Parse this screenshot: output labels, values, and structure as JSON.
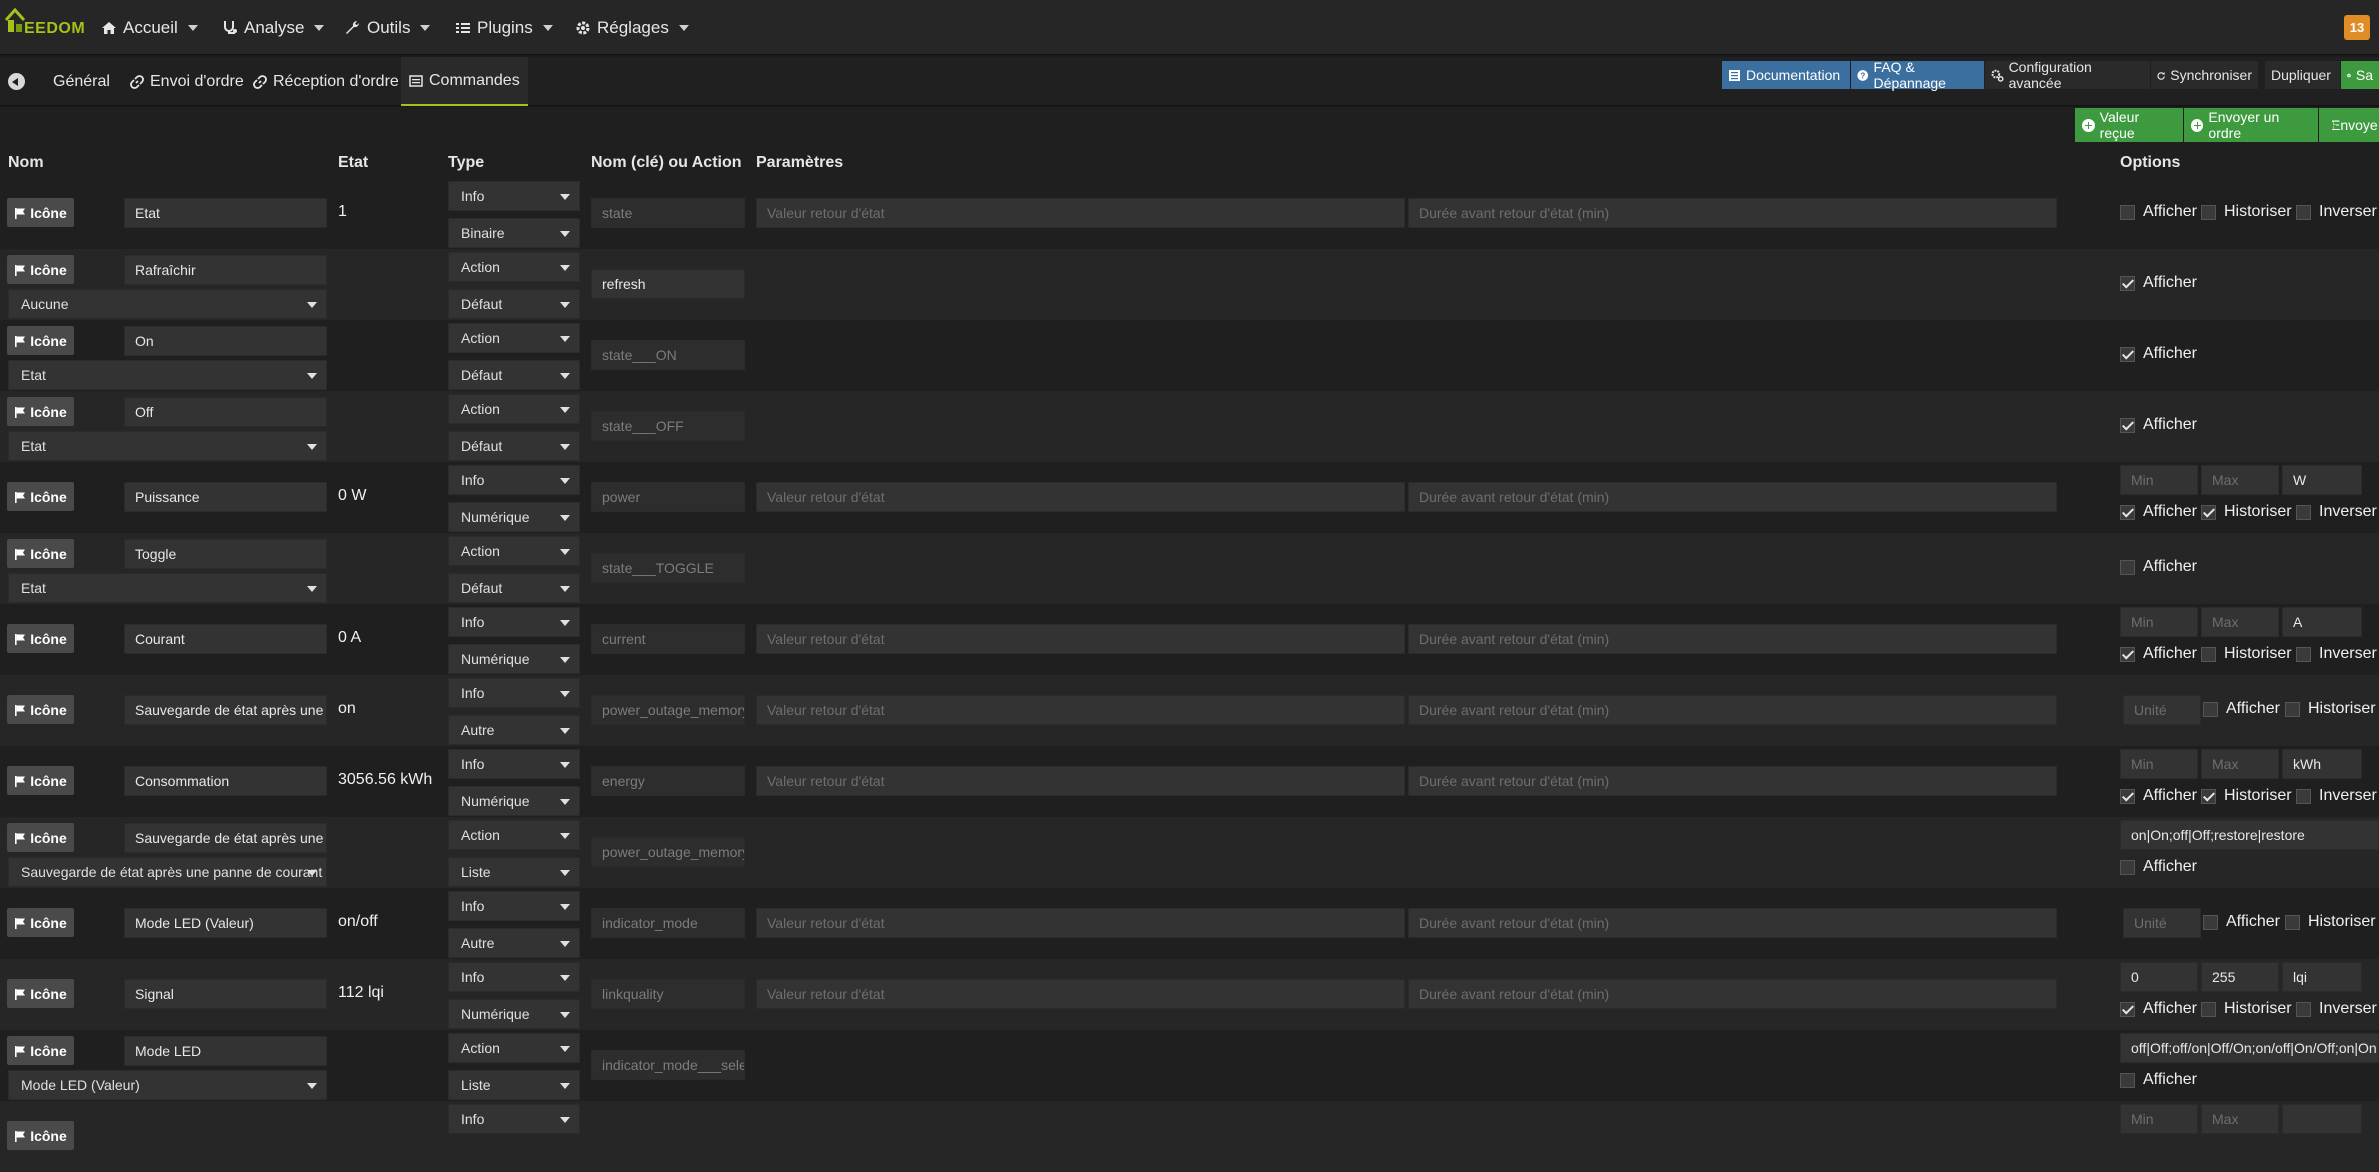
{
  "navbar": {
    "logo_text": "EEDOM",
    "items": [
      {
        "label": "Accueil",
        "icon": "home-icon"
      },
      {
        "label": "Analyse",
        "icon": "stethoscope-icon"
      },
      {
        "label": "Outils",
        "icon": "wrench-icon"
      },
      {
        "label": "Plugins",
        "icon": "list-icon"
      },
      {
        "label": "Réglages",
        "icon": "gear-icon"
      }
    ],
    "badge": "13"
  },
  "tabs": [
    "Général",
    "Envoi d'ordre",
    "Réception d'ordre",
    "Commandes"
  ],
  "toolbar": {
    "documentation": "Documentation",
    "faq": "FAQ & Dépannage",
    "config": "Configuration avancée",
    "sync": "Synchroniser",
    "duplicate": "Dupliquer",
    "save": "Sa"
  },
  "actions": {
    "valeur_recue": "Valeur reçue",
    "envoyer_ordre": "Envoyer un ordre",
    "envoyer": "Envoye"
  },
  "columns": {
    "nom": "Nom",
    "etat": "Etat",
    "type": "Type",
    "key": "Nom (clé) ou Action",
    "params": "Paramètres",
    "options": "Options"
  },
  "labels": {
    "icone": "Icône",
    "afficher": "Afficher",
    "historiser": "Historiser",
    "inverser": "Inverser",
    "param1": "Valeur retour d'état",
    "param2": "Durée avant retour d'état (min)",
    "min": "Min",
    "max": "Max",
    "unite": "Unité"
  },
  "rows": [
    {
      "name": "Etat",
      "etat": "1",
      "type": "Info",
      "subtype": "Binaire",
      "key": "state",
      "params": true,
      "options": "afficher-hist-inv",
      "afficher": false,
      "historiser": false,
      "inverser": false
    },
    {
      "name": "Rafraîchir",
      "linked": "Aucune",
      "type": "Action",
      "subtype": "Défaut",
      "key": "refresh",
      "key_bright": true,
      "options": "afficher",
      "afficher": true
    },
    {
      "name": "On",
      "linked": "Etat",
      "type": "Action",
      "subtype": "Défaut",
      "key": "state___ON",
      "options": "afficher",
      "afficher": true
    },
    {
      "name": "Off",
      "linked": "Etat",
      "type": "Action",
      "subtype": "Défaut",
      "key": "state___OFF",
      "options": "afficher",
      "afficher": true
    },
    {
      "name": "Puissance",
      "etat": "0 W",
      "type": "Info",
      "subtype": "Numérique",
      "key": "power",
      "params": true,
      "options": "minmax",
      "min": "",
      "max": "",
      "unit": "W",
      "afficher": true,
      "historiser": true,
      "inverser": false
    },
    {
      "name": "Toggle",
      "linked": "Etat",
      "type": "Action",
      "subtype": "Défaut",
      "key": "state___TOGGLE",
      "options": "afficher",
      "afficher": false
    },
    {
      "name": "Courant",
      "etat": "0 A",
      "type": "Info",
      "subtype": "Numérique",
      "key": "current",
      "params": true,
      "options": "minmax",
      "min": "",
      "max": "",
      "unit": "A",
      "afficher": true,
      "historiser": false,
      "inverser": false
    },
    {
      "name": "Sauvegarde de état après une panne de courant",
      "etat": "on",
      "type": "Info",
      "subtype": "Autre",
      "key": "power_outage_memory",
      "params": true,
      "options": "unite",
      "afficher": false,
      "historiser": false
    },
    {
      "name": "Consommation",
      "etat": "3056.56 kWh",
      "type": "Info",
      "subtype": "Numérique",
      "key": "energy",
      "params": true,
      "options": "minmax",
      "min": "",
      "max": "",
      "unit": "kWh",
      "afficher": true,
      "historiser": true,
      "inverser": false
    },
    {
      "name": "Sauvegarde de état après une panne de courant",
      "linked": "Sauvegarde de état après une panne de courant",
      "type": "Action",
      "subtype": "Liste",
      "key": "power_outage_memory",
      "options": "list",
      "list": "on|On;off|Off;restore|restore",
      "afficher": false
    },
    {
      "name": "Mode LED (Valeur)",
      "etat": "on/off",
      "type": "Info",
      "subtype": "Autre",
      "key": "indicator_mode",
      "params": true,
      "options": "unite",
      "afficher": false,
      "historiser": false
    },
    {
      "name": "Signal",
      "etat": "112 lqi",
      "type": "Info",
      "subtype": "Numérique",
      "key": "linkquality",
      "params": true,
      "options": "minmax",
      "min": "0",
      "max": "255",
      "unit": "lqi",
      "afficher": true,
      "historiser": false,
      "inverser": false
    },
    {
      "name": "Mode LED",
      "linked": "Mode LED (Valeur)",
      "type": "Action",
      "subtype": "Liste",
      "key": "indicator_mode___select",
      "options": "list",
      "list": "off|Off;off/on|Off/On;on/off|On/Off;on|On",
      "afficher": false
    },
    {
      "name": "",
      "type": "Info",
      "subtype": "",
      "key": "",
      "options": "minmax",
      "min": "",
      "max": "",
      "unit": "",
      "partial": true
    }
  ]
}
